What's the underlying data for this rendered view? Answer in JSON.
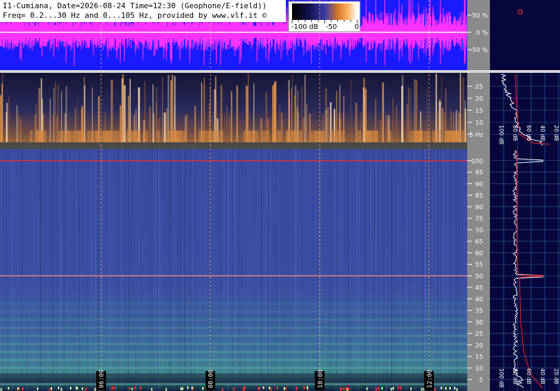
{
  "header": {
    "title_line1": "I1-Cumiana, Date=2026-08-24 Time=12:30 (Geophone/E-field))",
    "title_line2": "Freq= 0.2...30 Hz and 0...105 Hz, provided by www.vlf.it ©"
  },
  "colorbar": {
    "tick_labels": [
      "-100 dB",
      "-50",
      "0"
    ],
    "range_db": [
      -100,
      0
    ]
  },
  "waveform": {
    "axis_labels": [
      "50 %",
      "0 %",
      "-50 %"
    ],
    "axis_values": [
      50,
      0,
      -50
    ],
    "colors": {
      "background": "#1a1aff",
      "trace": "#ff33ff",
      "center": "#ffffff"
    }
  },
  "time_axis": {
    "labels": [
      "06:00",
      "08:00",
      "10:00",
      "12:00"
    ],
    "values_hours": [
      6,
      8,
      10,
      12
    ],
    "range_hours": [
      4.15,
      12.7
    ]
  },
  "chart_data": [
    {
      "type": "heatmap",
      "name": "geophone spectrogram 0.2-30 Hz",
      "ylim": [
        0,
        30
      ],
      "y_ticks": [
        5,
        10,
        15,
        20,
        25
      ],
      "y_tick_labels": [
        "5 Hz",
        "10",
        "15",
        "20",
        "25"
      ],
      "palette": "black-blue-orange-white"
    },
    {
      "type": "heatmap",
      "name": "e-field spectrogram 0-105 Hz",
      "ylim": [
        0,
        105
      ],
      "y_ticks": [
        5,
        10,
        15,
        20,
        25,
        30,
        35,
        40,
        45,
        50,
        55,
        60,
        65,
        70,
        75,
        80,
        85,
        90,
        95,
        100
      ],
      "y_tick_labels": [
        "5",
        "10",
        "15",
        "20",
        "25",
        "30",
        "35",
        "40",
        "45",
        "50",
        "55",
        "60",
        "65",
        "70",
        "75",
        "80",
        "85",
        "90",
        "95",
        "100"
      ],
      "marker_lines_hz": [
        50,
        100
      ],
      "palette": "blue-cyan-green"
    },
    {
      "type": "line",
      "name": "average spectrum upper",
      "x_tick_labels": [
        "100 dB",
        "80 dB",
        "60 dB",
        "40 dB",
        "20 dB"
      ],
      "profile_x": [
        0.18,
        0.22,
        0.28,
        0.35,
        0.4,
        0.42,
        0.5,
        0.62,
        0.78
      ],
      "profile_y_hz": [
        29,
        25,
        20,
        15,
        10,
        7,
        5,
        3,
        1
      ]
    },
    {
      "type": "line",
      "name": "average spectrum lower",
      "x_tick_labels": [
        "100 dB",
        "80 dB",
        "60 dB",
        "40 dB",
        "20 dB"
      ],
      "peaks_hz": [
        50,
        100
      ]
    }
  ]
}
